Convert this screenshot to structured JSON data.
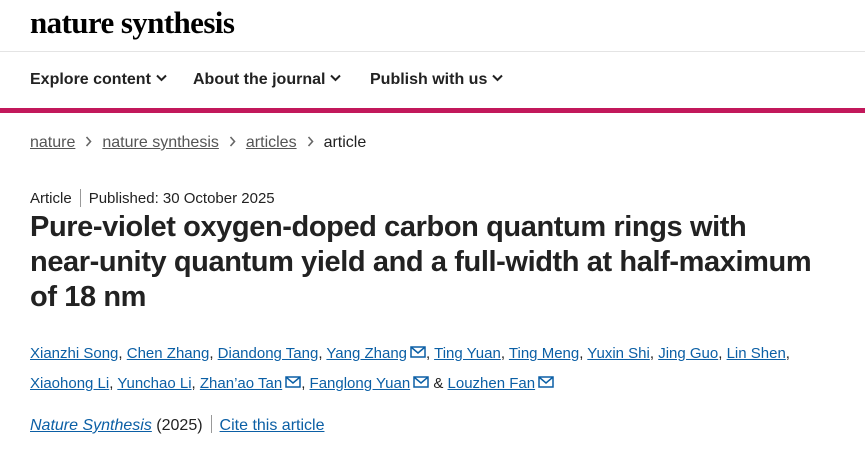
{
  "site": {
    "logo": "nature synthesis"
  },
  "nav": {
    "items": [
      {
        "label": "Explore content"
      },
      {
        "label": "About the journal"
      },
      {
        "label": "Publish with us"
      }
    ]
  },
  "colors": {
    "accent_bar": "#c2185b",
    "link": "#0b5fa5"
  },
  "breadcrumb": [
    "nature",
    "nature synthesis",
    "articles",
    "article"
  ],
  "article": {
    "type": "Article",
    "published": "Published: 30 October 2025",
    "title": "Pure-violet oxygen-doped carbon quantum rings with near-unity quantum yield and a full-width at half-maximum of 18  nm",
    "authors": [
      {
        "name": "Xianzhi Song",
        "email": false
      },
      {
        "name": "Chen Zhang",
        "email": false
      },
      {
        "name": "Diandong Tang",
        "email": false
      },
      {
        "name": "Yang Zhang",
        "email": true
      },
      {
        "name": "Ting Yuan",
        "email": false
      },
      {
        "name": "Ting Meng",
        "email": false
      },
      {
        "name": "Yuxin Shi",
        "email": false
      },
      {
        "name": "Jing Guo",
        "email": false
      },
      {
        "name": "Lin Shen",
        "email": false
      },
      {
        "name": "Xiaohong Li",
        "email": false
      },
      {
        "name": "Yunchao Li",
        "email": false
      },
      {
        "name": "Zhan’ao Tan",
        "email": true
      },
      {
        "name": "Fanglong Yuan",
        "email": true
      },
      {
        "name": "Louzhen Fan",
        "email": true
      }
    ],
    "journal": "Nature Synthesis",
    "year": "(2025)",
    "cite_label": "Cite this article"
  }
}
